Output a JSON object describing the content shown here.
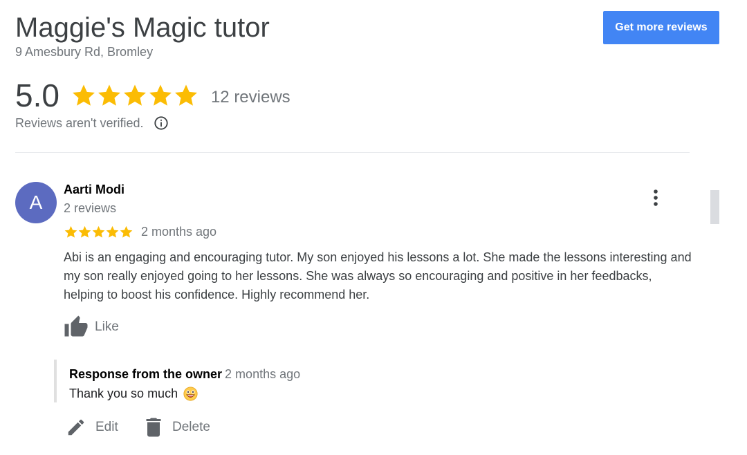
{
  "business": {
    "name": "Maggie's Magic tutor",
    "address": "9 Amesbury Rd, Bromley"
  },
  "header": {
    "more_reviews_label": "Get more reviews",
    "accent_color": "#4285f4"
  },
  "summary": {
    "rating": "5.0",
    "stars": 5,
    "review_count": "12 reviews",
    "verification_note": "Reviews aren't verified.",
    "star_color": "#fbbc04"
  },
  "review": {
    "avatar_letter": "A",
    "avatar_color": "#5c6bc0",
    "reviewer_name": "Aarti Modi",
    "reviewer_review_count": "2 reviews",
    "stars": 5,
    "date": "2 months ago",
    "text": "Abi is an engaging and encouraging tutor. My son enjoyed his lessons a lot. She made the lessons interesting and my son really enjoyed going to her lessons. She was always so encouraging and positive in her feedbacks, helping to boost his confidence. Highly recommend her.",
    "like_label": "Like",
    "menu_icon": "more-vert-icon"
  },
  "owner_response": {
    "title": "Response from the owner",
    "date": "2 months ago",
    "text": "Thank you so much",
    "emoji_icon": "grinning-face-icon"
  },
  "actions": {
    "edit_label": "Edit",
    "delete_label": "Delete"
  }
}
